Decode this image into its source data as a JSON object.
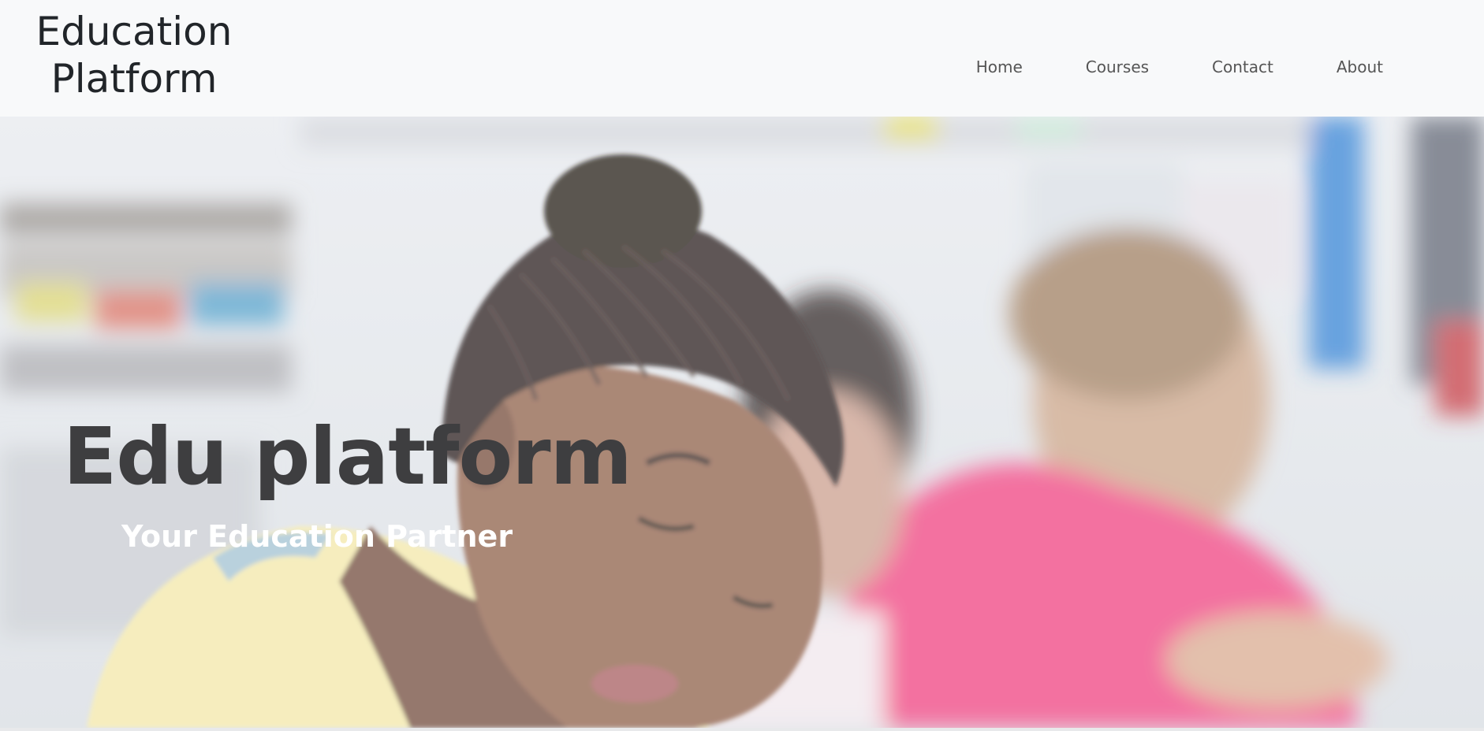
{
  "navbar": {
    "brand": "Education\nPlatform",
    "links": [
      {
        "label": "Home"
      },
      {
        "label": "Courses"
      },
      {
        "label": "Contact"
      },
      {
        "label": "About"
      }
    ]
  },
  "hero": {
    "title": "Edu platform",
    "subtitle": "Your Education Partner",
    "image_description_icon": "classroom-students-photo"
  },
  "colors": {
    "navbar_bg": "#f8f9fa",
    "brand_text": "#212529",
    "nav_text": "#555555",
    "hero_title": "#3e3e40",
    "hero_subtitle": "#ffffff"
  }
}
